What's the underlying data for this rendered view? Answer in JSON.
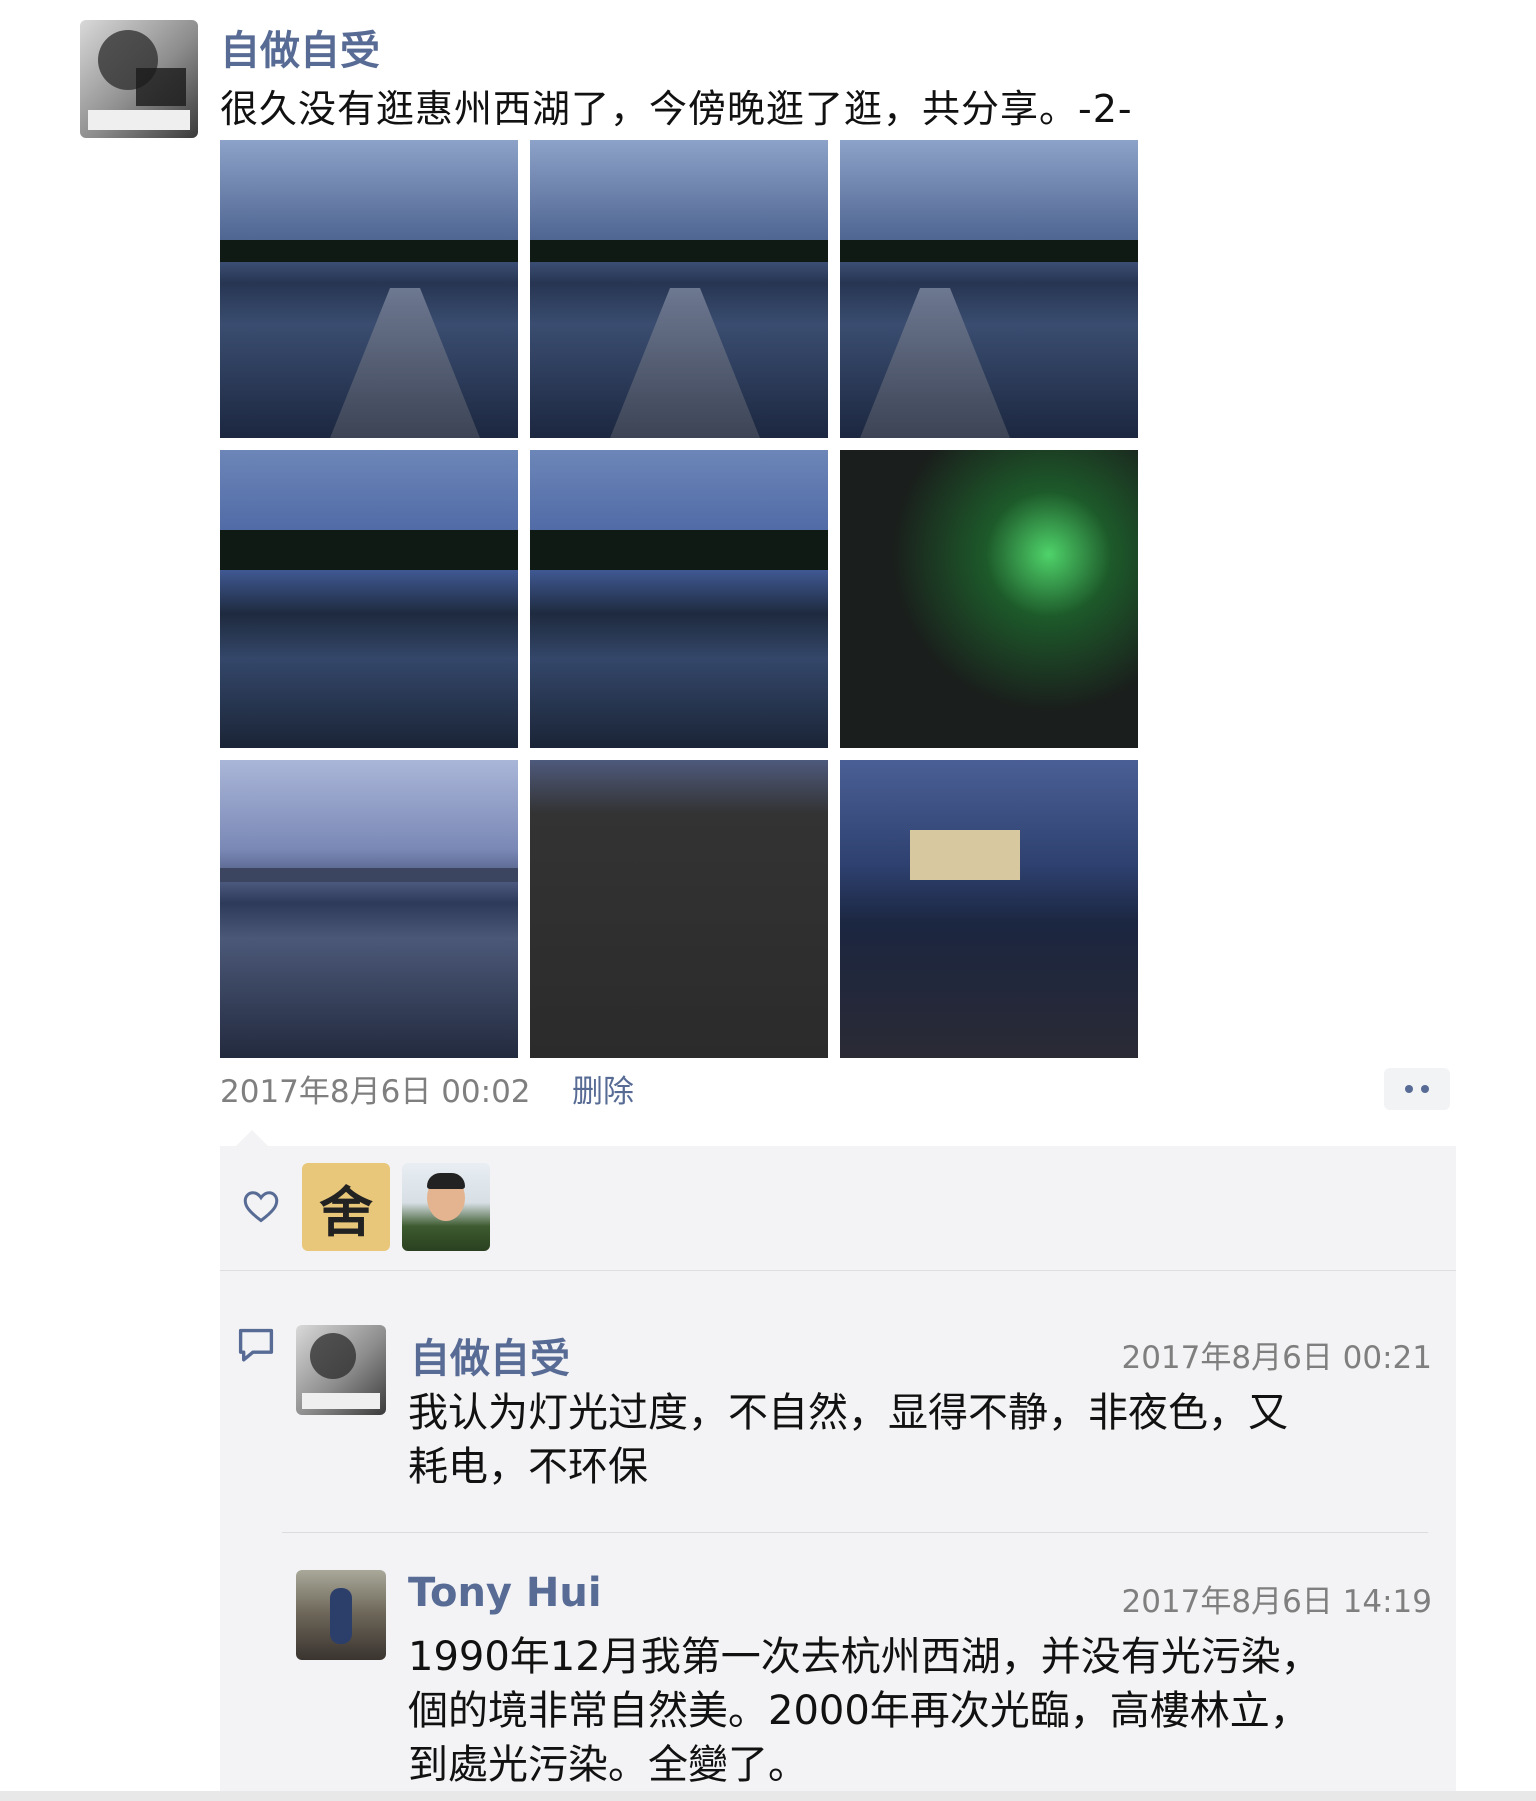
{
  "post": {
    "author": "自做自受",
    "text": "很久没有逛惠州西湖了，今傍晚逛了逛，共分享。-2-",
    "photos": [
      {
        "icon": "photo-bridge-dusk-1"
      },
      {
        "icon": "photo-bridge-dusk-2"
      },
      {
        "icon": "photo-bridge-dusk-3"
      },
      {
        "icon": "photo-lake-pagoda-1"
      },
      {
        "icon": "photo-lake-pagoda-2"
      },
      {
        "icon": "photo-tree-green-light"
      },
      {
        "icon": "photo-lake-city-skyline"
      },
      {
        "icon": "photo-stone-railing"
      },
      {
        "icon": "photo-lake-pavilion"
      }
    ],
    "time": "2017年8月6日 00:02",
    "delete_label": "删除"
  },
  "likes": {
    "avatars": [
      {
        "icon": "avatar-calligraphy",
        "glyph": "舍"
      },
      {
        "icon": "avatar-uniform-man"
      }
    ]
  },
  "comments": [
    {
      "author": "自做自受",
      "time": "2017年8月6日 00:21",
      "text_line1": "我认为灯光过度，不自然，显得不静，非夜色，又",
      "text_line2": "耗电，不环保"
    },
    {
      "author": "Tony Hui",
      "time": "2017年8月6日 14:19",
      "text_line1": "1990年12月我第一次去杭州西湖，并没有光污染，",
      "text_line2": "個的境非常自然美。2000年再次光臨，高樓林立，",
      "text_line3": "到處光污染。全變了。"
    }
  ],
  "colors": {
    "link_name": "#576b95",
    "meta_gray": "#7f7f7f",
    "box_bg": "#f3f3f5"
  }
}
